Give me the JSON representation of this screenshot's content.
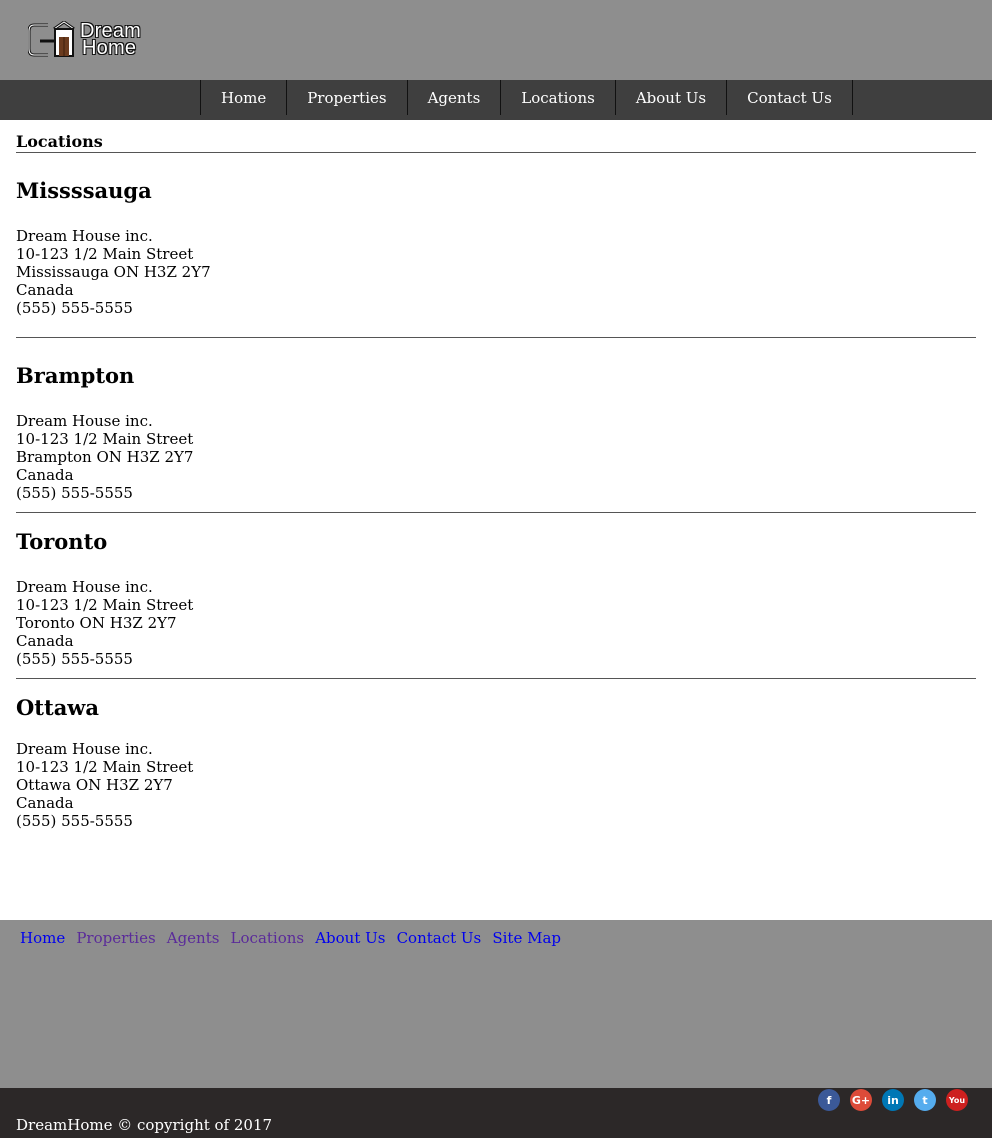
{
  "logo": {
    "line1": "Dream",
    "line2": "Home"
  },
  "nav": {
    "items": [
      "Home",
      "Properties",
      "Agents",
      "Locations",
      "About Us",
      "Contact Us"
    ]
  },
  "page": {
    "title": "Locations"
  },
  "locations": [
    {
      "name": "Missssauga",
      "company": "Dream House inc.",
      "street": "10-123 1/2 Main Street",
      "city": "Mississauga ON H3Z 2Y7",
      "country": "Canada",
      "phone": "(555) 555-5555"
    },
    {
      "name": "Brampton",
      "company": "Dream House inc.",
      "street": "10-123 1/2 Main Street",
      "city": "Brampton ON H3Z 2Y7",
      "country": "Canada",
      "phone": "(555) 555-5555"
    },
    {
      "name": "Toronto",
      "company": "Dream House inc.",
      "street": "10-123 1/2 Main Street",
      "city": "Toronto ON H3Z 2Y7",
      "country": "Canada",
      "phone": "(555) 555-5555"
    },
    {
      "name": "Ottawa",
      "company": "Dream House inc.",
      "street": "10-123 1/2 Main Street",
      "city": "Ottawa ON H3Z 2Y7",
      "country": "Canada",
      "phone": "(555) 555-5555"
    }
  ],
  "footer": {
    "links": [
      "Home",
      "Properties",
      "Agents",
      "Locations",
      "About Us",
      "Contact Us",
      "Site Map"
    ],
    "copyright": "DreamHome © copyright of 2017",
    "social": [
      {
        "icon": "facebook-icon",
        "glyph": "f",
        "color": "#3b5998"
      },
      {
        "icon": "google-plus-icon",
        "glyph": "G+",
        "color": "#dd4b39"
      },
      {
        "icon": "linkedin-icon",
        "glyph": "in",
        "color": "#0077b5"
      },
      {
        "icon": "twitter-icon",
        "glyph": "t",
        "color": "#55acee"
      },
      {
        "icon": "youtube-icon",
        "glyph": "You",
        "color": "#cd201f"
      }
    ]
  }
}
